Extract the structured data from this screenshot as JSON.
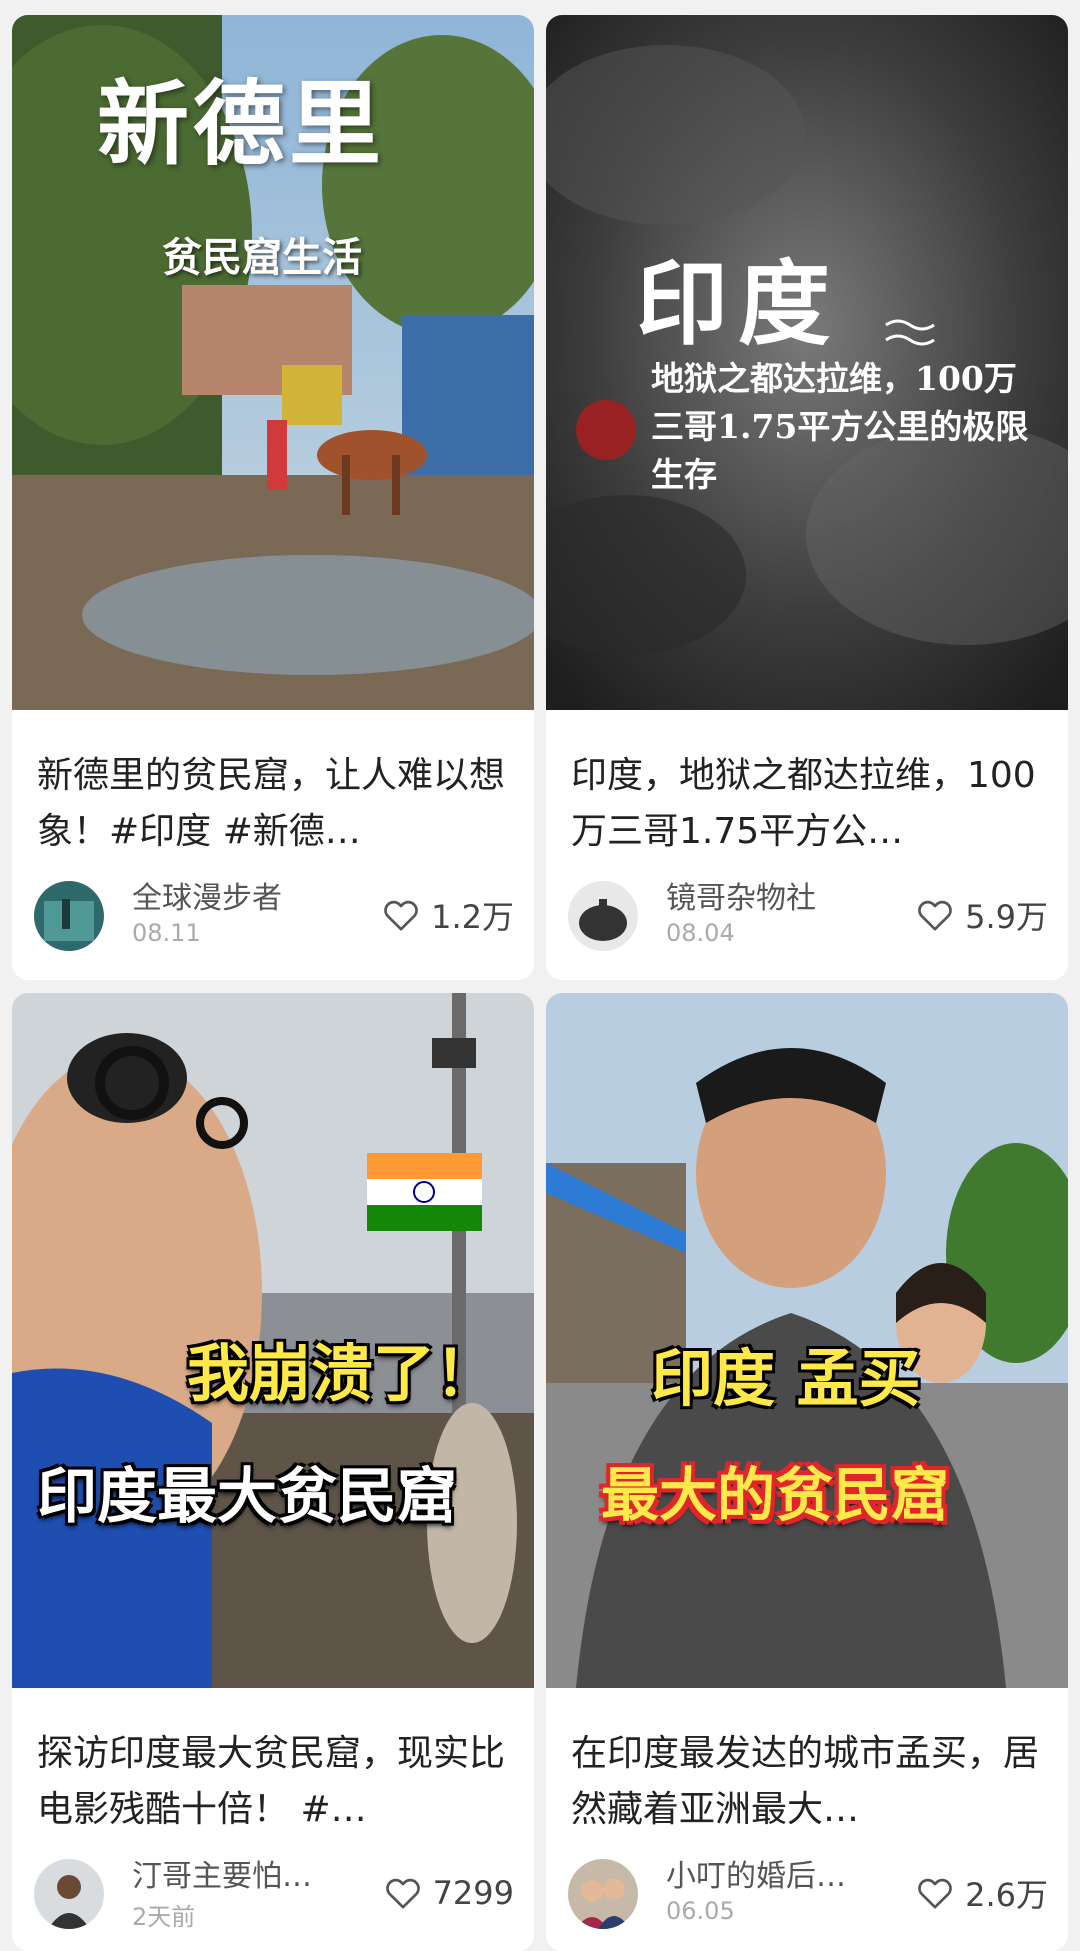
{
  "feed": {
    "cards": [
      {
        "thumb_title": "新德里",
        "thumb_subtitle": "贫民窟生活",
        "title": "新德里的贫民窟，让人难以想象！#印度 #新德…",
        "author": "全球漫步者",
        "date": "08.11",
        "likes": "1.2万"
      },
      {
        "thumb_title": "印度",
        "thumb_subtitle": "地狱之都达拉维，100万三哥1.75平方公里的极限生存",
        "title": "印度，地狱之都达拉维，100万三哥1.75平方公…",
        "author": "镜哥杂物社",
        "date": "08.04",
        "likes": "5.9万"
      },
      {
        "thumb_title": "我崩溃了！",
        "thumb_subtitle": "印度最大贫民窟",
        "title": "探访印度最大贫民窟，现实比电影残酷十倍！ #…",
        "author": "汀哥主要怕…",
        "date": "2天前",
        "likes": "7299"
      },
      {
        "thumb_title": "印度 孟买",
        "thumb_subtitle": "最大的贫民窟",
        "title": "在印度最发达的城市孟买，居然藏着亚洲最大…",
        "author": "小叮的婚后…",
        "date": "06.05",
        "likes": "2.6万"
      }
    ]
  },
  "colors": {
    "background": "#f1f1f1",
    "card": "#ffffff",
    "title_text": "#222222",
    "meta_text": "#555555",
    "date_text": "#aaaaaa",
    "overlay_yellow": "#ffe84a",
    "overlay_red": "#e0262b"
  },
  "icons": {
    "like": "heart-outline-icon"
  }
}
